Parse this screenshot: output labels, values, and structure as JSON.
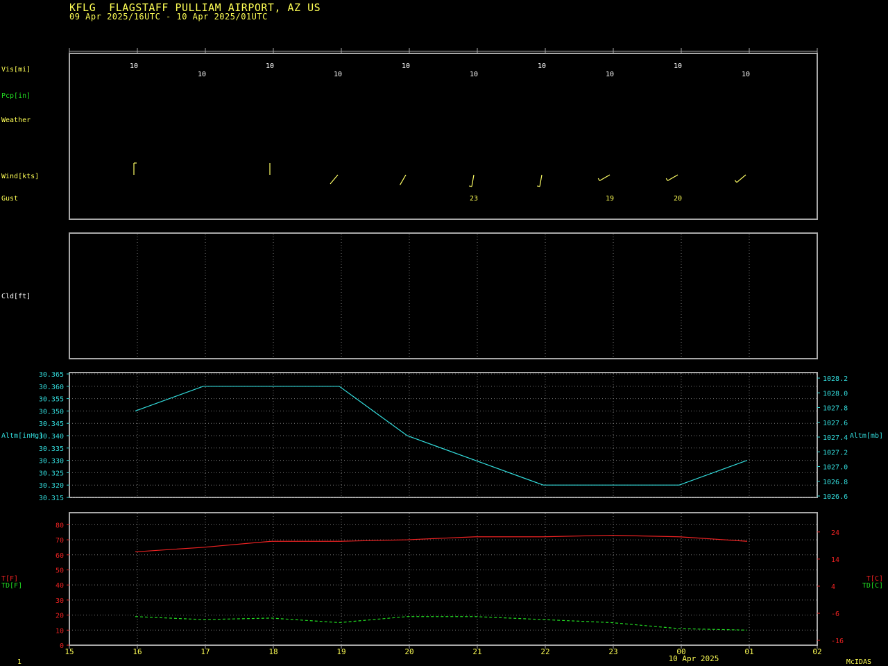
{
  "header": {
    "station": "KFLG  FLAGSTAFF PULLIAM AIRPORT, AZ US",
    "period": "09 Apr 2025/16UTC - 10 Apr 2025/01UTC"
  },
  "colors": {
    "background": "#000000",
    "frame": "#a8a8a8",
    "grid": "#7a7a7a",
    "text_yellow": "#ffff55",
    "altimeter": "#33dddd",
    "temperature": "#ee2222",
    "dewpoint": "#22dd22"
  },
  "row_labels": {
    "vis": "Vis[mi]",
    "pcp": "Pcp[in]",
    "weather": "Weather",
    "wind": "Wind[kts]",
    "gust": "Gust",
    "cld": "Cld[ft]",
    "altm_left": "Altm[inHg]",
    "altm_right": "Altm[mb]",
    "t_left": "T[F]",
    "td_left": "TD[F]",
    "t_right": "T[C]",
    "td_right": "TD[C]"
  },
  "footer": {
    "frame_number": "1",
    "date_label": "10 Apr 2025",
    "brand": "McIDAS"
  },
  "chart_data": {
    "type": "line",
    "x_hours": [
      16,
      17,
      18,
      19,
      20,
      21,
      22,
      23,
      24,
      25
    ],
    "x_range": [
      15,
      26
    ],
    "x_tick_labels": [
      "15",
      "16",
      "17",
      "18",
      "19",
      "20",
      "21",
      "22",
      "23",
      "00",
      "01",
      "02"
    ],
    "visibility": {
      "unit": "mi",
      "labels": [
        "10",
        "10",
        "10",
        "10",
        "10",
        "10",
        "10",
        "10",
        "10",
        "10"
      ]
    },
    "wind": {
      "unit": "kts",
      "barbs": [
        {
          "hour": 16,
          "dir": 360,
          "speed": 5
        },
        {
          "hour": 18,
          "dir": 360,
          "speed": 0
        },
        {
          "hour": 19,
          "dir": 220,
          "speed": 0
        },
        {
          "hour": 20,
          "dir": 210,
          "speed": 0
        },
        {
          "hour": 21,
          "dir": 190,
          "speed": 5
        },
        {
          "hour": 22,
          "dir": 190,
          "speed": 5
        },
        {
          "hour": 23,
          "dir": 240,
          "speed": 5
        },
        {
          "hour": 24,
          "dir": 240,
          "speed": 5
        },
        {
          "hour": 25,
          "dir": 230,
          "speed": 5
        }
      ]
    },
    "gust": [
      {
        "hour": 21,
        "label": "23"
      },
      {
        "hour": 23,
        "label": "19"
      },
      {
        "hour": 24,
        "label": "20"
      }
    ],
    "altimeter": {
      "series": [
        {
          "name": "Altm[inHg]",
          "values": [
            30.35,
            30.36,
            30.36,
            30.36,
            30.34,
            30.33,
            30.32,
            30.32,
            30.32,
            30.33
          ]
        }
      ],
      "ylim_left": [
        30.315,
        30.365
      ],
      "left_ticks": [
        "30.315",
        "30.320",
        "30.325",
        "30.330",
        "30.335",
        "30.340",
        "30.345",
        "30.350",
        "30.355",
        "30.360",
        "30.365"
      ],
      "ylim_right": [
        1026.6,
        1028.2
      ],
      "right_ticks": [
        "1026.6",
        "1026.8",
        "1027.0",
        "1027.2",
        "1027.4",
        "1027.6",
        "1027.8",
        "1028.0",
        "1028.2"
      ]
    },
    "temperature": {
      "series": [
        {
          "name": "T[F]",
          "values": [
            62,
            65,
            69,
            69,
            70,
            72,
            72,
            73,
            72,
            69
          ]
        },
        {
          "name": "TD[F]",
          "values": [
            19,
            17,
            18,
            15,
            19,
            19,
            17,
            15,
            11,
            10
          ]
        }
      ],
      "ylim_left": [
        0,
        88
      ],
      "left_ticks": [
        "0",
        "10",
        "20",
        "30",
        "40",
        "50",
        "60",
        "70",
        "80"
      ],
      "right_ticks": [
        {
          "label": "-16",
          "value_c": -16
        },
        {
          "label": "-6",
          "value_c": -6
        },
        {
          "label": "4",
          "value_c": 4
        },
        {
          "label": "14",
          "value_c": 14
        },
        {
          "label": "24",
          "value_c": 24
        }
      ]
    }
  }
}
